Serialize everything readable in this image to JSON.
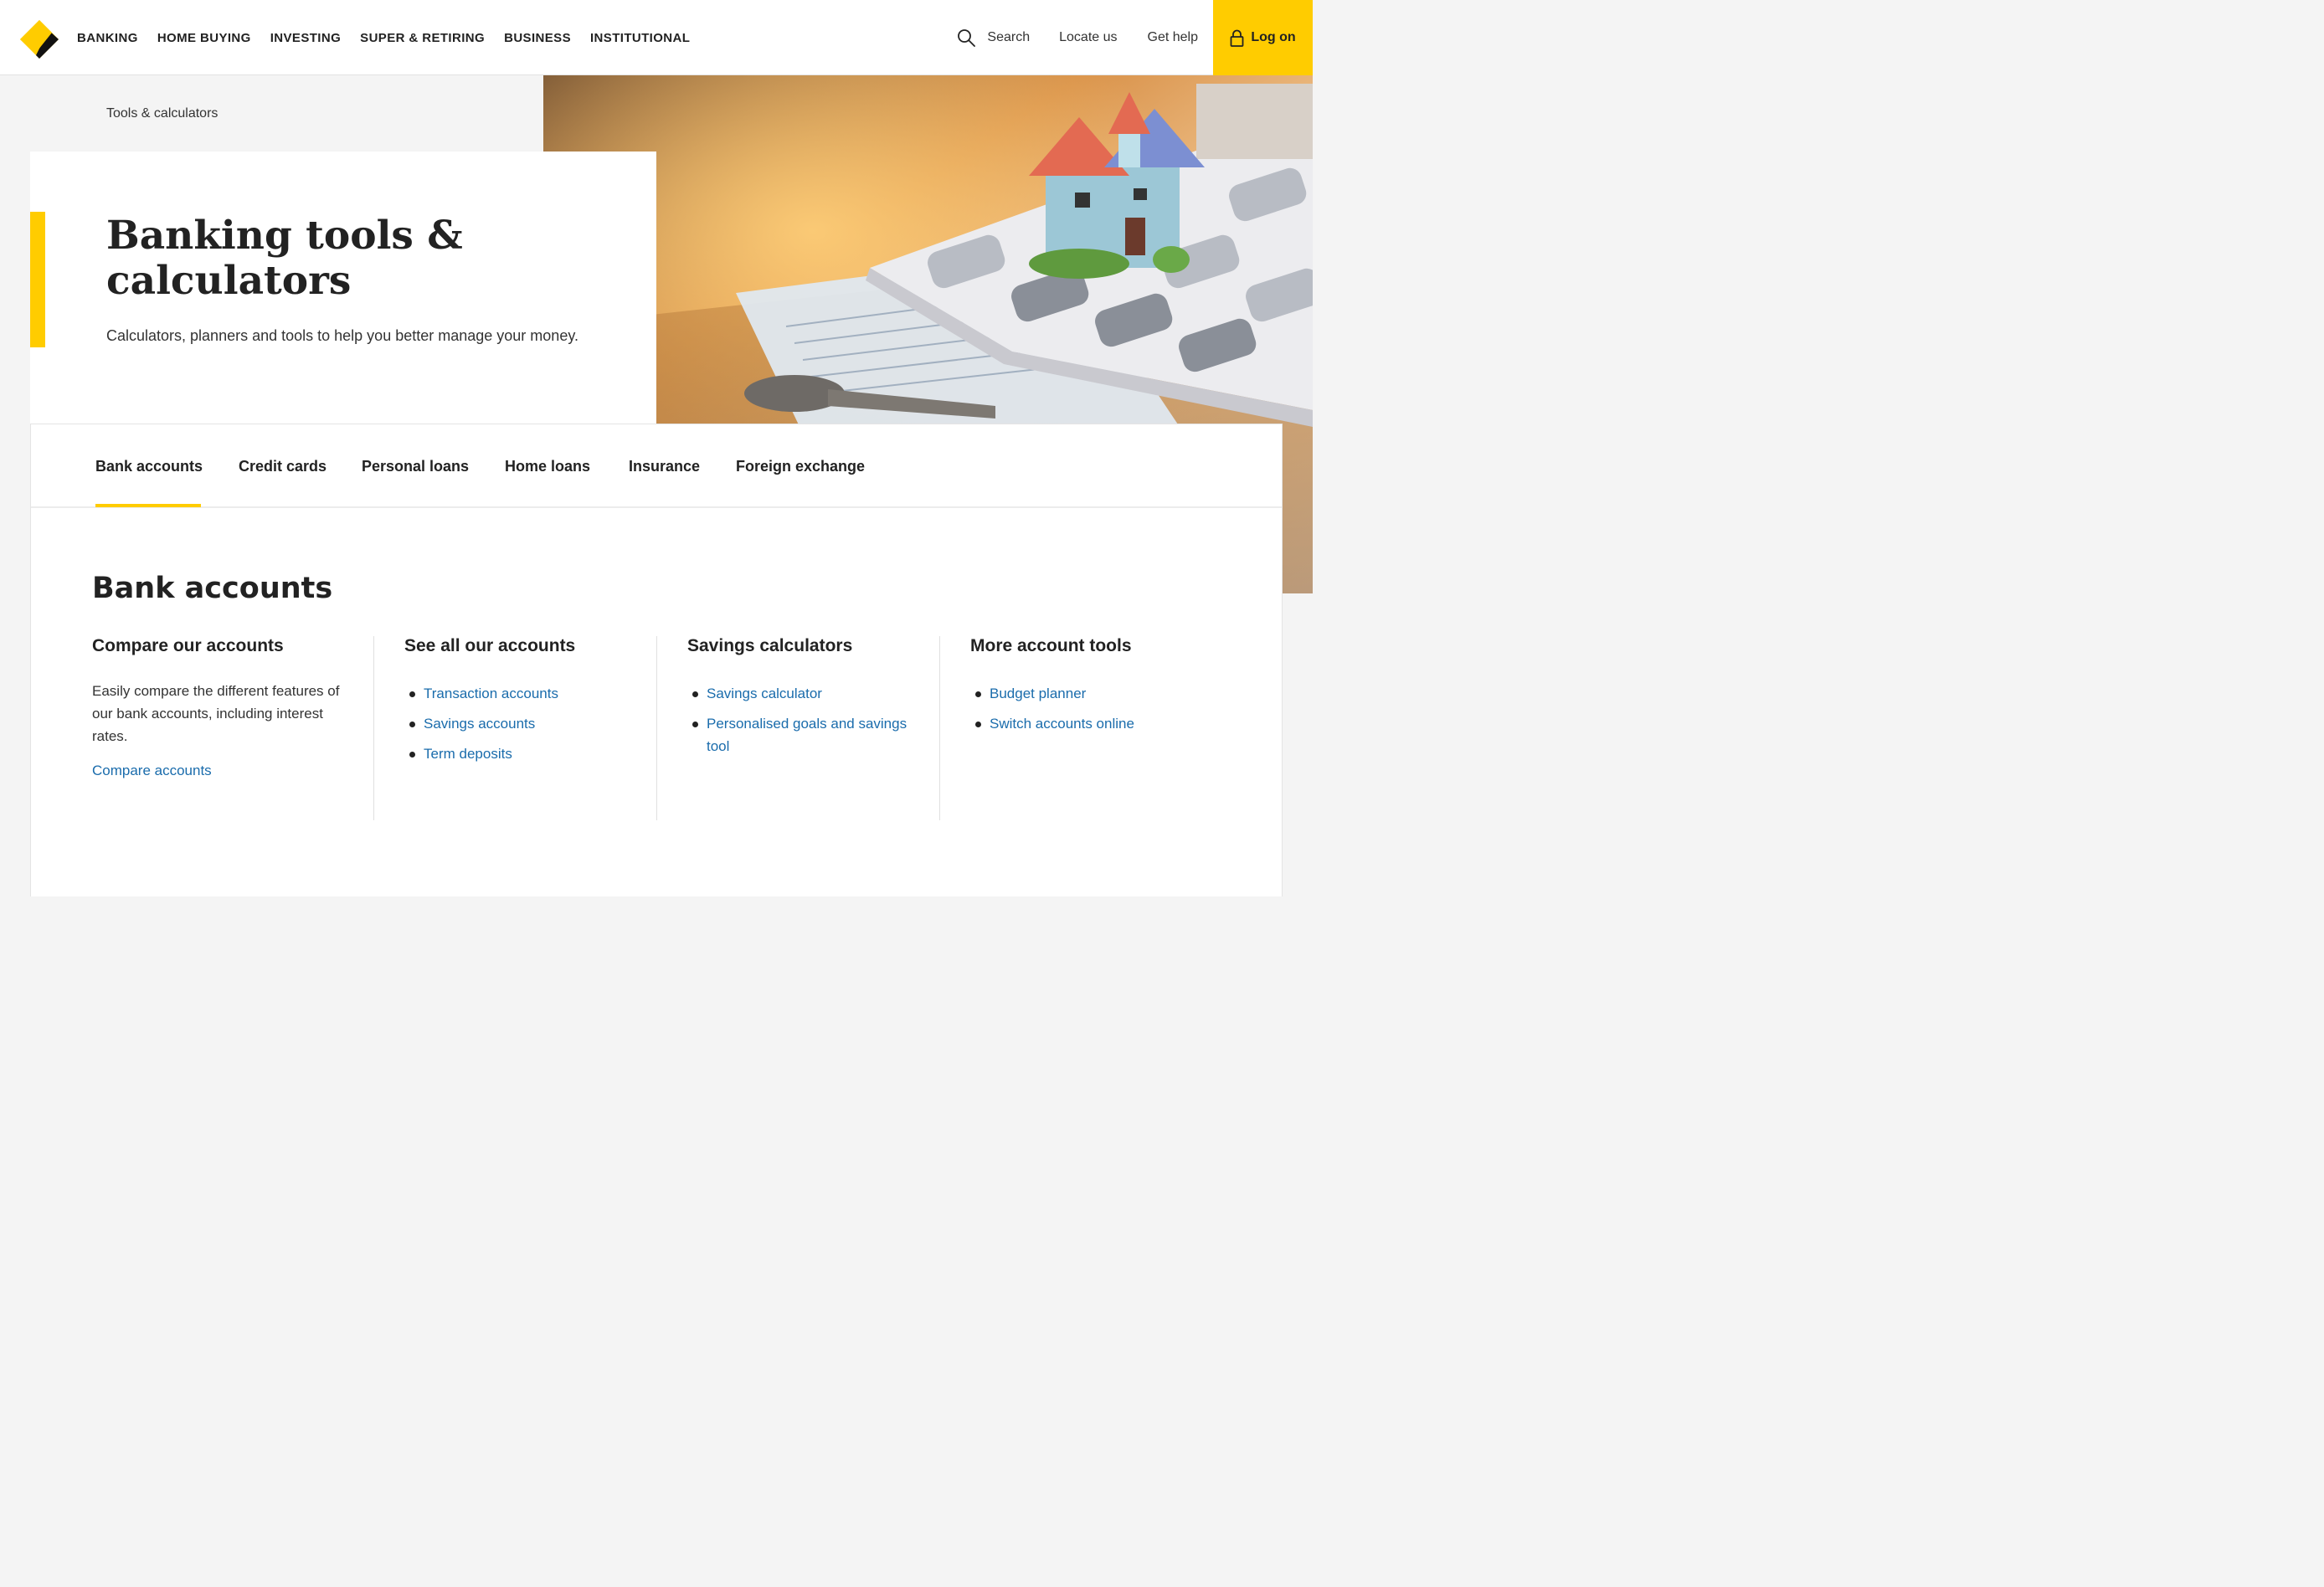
{
  "header": {
    "nav": [
      "BANKING",
      "HOME BUYING",
      "INVESTING",
      "SUPER & RETIRING",
      "BUSINESS",
      "INSTITUTIONAL"
    ],
    "search_label": "Search",
    "locate_label": "Locate us",
    "help_label": "Get help",
    "logon_label": "Log on"
  },
  "hero": {
    "breadcrumb": "Tools & calculators",
    "title": "Banking tools & calculators",
    "subtitle": "Calculators, planners and tools to help you better manage your money."
  },
  "tabs": {
    "items": [
      "Bank accounts",
      "Credit cards",
      "Personal loans",
      "Home loans",
      "Insurance",
      "Foreign exchange"
    ],
    "active": "Bank accounts"
  },
  "section": {
    "title": "Bank accounts",
    "columns": [
      {
        "title": "Compare our accounts",
        "description": "Easily compare the different features of our bank accounts, including interest rates.",
        "link": "Compare accounts"
      },
      {
        "title": "See all our accounts",
        "links": [
          "Transaction accounts",
          "Savings accounts",
          "Term deposits"
        ]
      },
      {
        "title": "Savings calculators",
        "links": [
          "Savings calculator",
          "Personalised goals and savings tool"
        ]
      },
      {
        "title": "More account tools",
        "links": [
          "Budget planner",
          "Switch accounts online"
        ]
      }
    ]
  },
  "colors": {
    "brand_yellow": "#ffcc00",
    "link_blue": "#1a6cac",
    "text_dark": "#222222"
  },
  "icons": {
    "logo": "commbank-diamond-logo",
    "search": "search-icon",
    "lock": "lock-icon"
  }
}
